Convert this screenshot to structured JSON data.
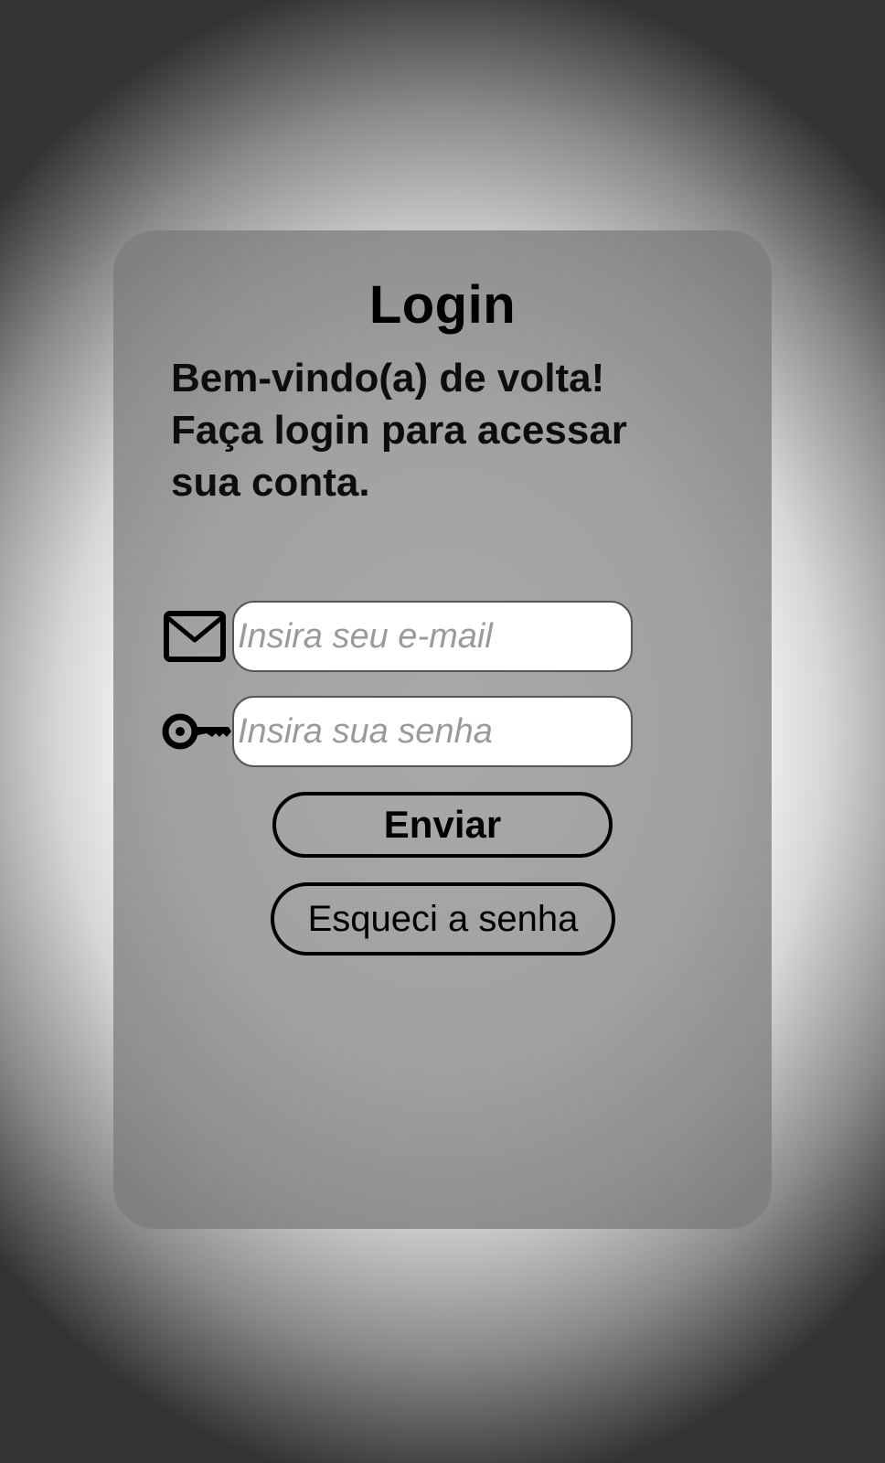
{
  "login": {
    "title": "Login",
    "welcome_line1": "Bem-vindo(a) de volta!",
    "welcome_line2": "Faça login para acessar",
    "welcome_line3": "sua conta.",
    "email": {
      "icon": "mail-icon",
      "placeholder": "Insira seu e-mail",
      "value": ""
    },
    "password": {
      "icon": "key-icon",
      "placeholder": "Insira sua senha",
      "value": ""
    },
    "send_label": "Enviar",
    "forgot_label": "Esqueci a senha"
  },
  "colors": {
    "card": "#a1a1a1",
    "input_background": "#ffffff",
    "text": "#000000",
    "placeholder": "#9a9a9a"
  }
}
